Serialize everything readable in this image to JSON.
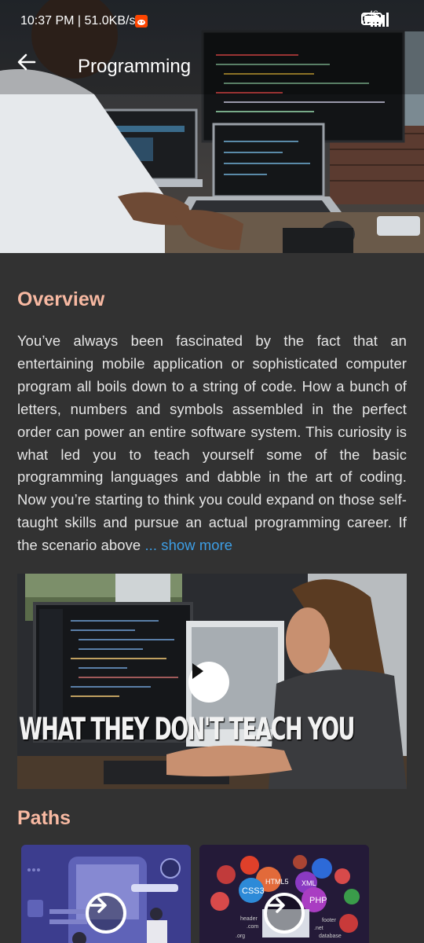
{
  "status_bar": {
    "time_speed": "10:37 PM | 51.0KB/s",
    "network_label": "4G"
  },
  "header": {
    "title": "Programming"
  },
  "overview": {
    "heading": "Overview",
    "text": "You’ve always been fascinated by the fact that an entertaining mobile application or sophisticated computer program all boils down to a string of code. How a bunch of letters, numbers and symbols assembled in the perfect order can power an entire software system. This curiosity is what led you to teach yourself some of the basic programming languages and dabble in the art of coding. Now you’re starting to think you could expand on those self-taught skills and pursue an actual programming career. If the scenario above",
    "show_more": "... show more"
  },
  "video": {
    "caption": "WHAT THEY DON'T TEACH YOU"
  },
  "paths": {
    "heading": "Paths",
    "card2_tags": [
      "HTML5",
      "XML",
      "CSS3",
      "PHP",
      "header",
      ".com",
      "footer",
      ".net",
      ".org",
      "database"
    ]
  },
  "colors": {
    "background": "#323232",
    "heading_accent": "#f8b9a2",
    "link": "#3d9ee5",
    "body_text": "#e6e6e6"
  }
}
